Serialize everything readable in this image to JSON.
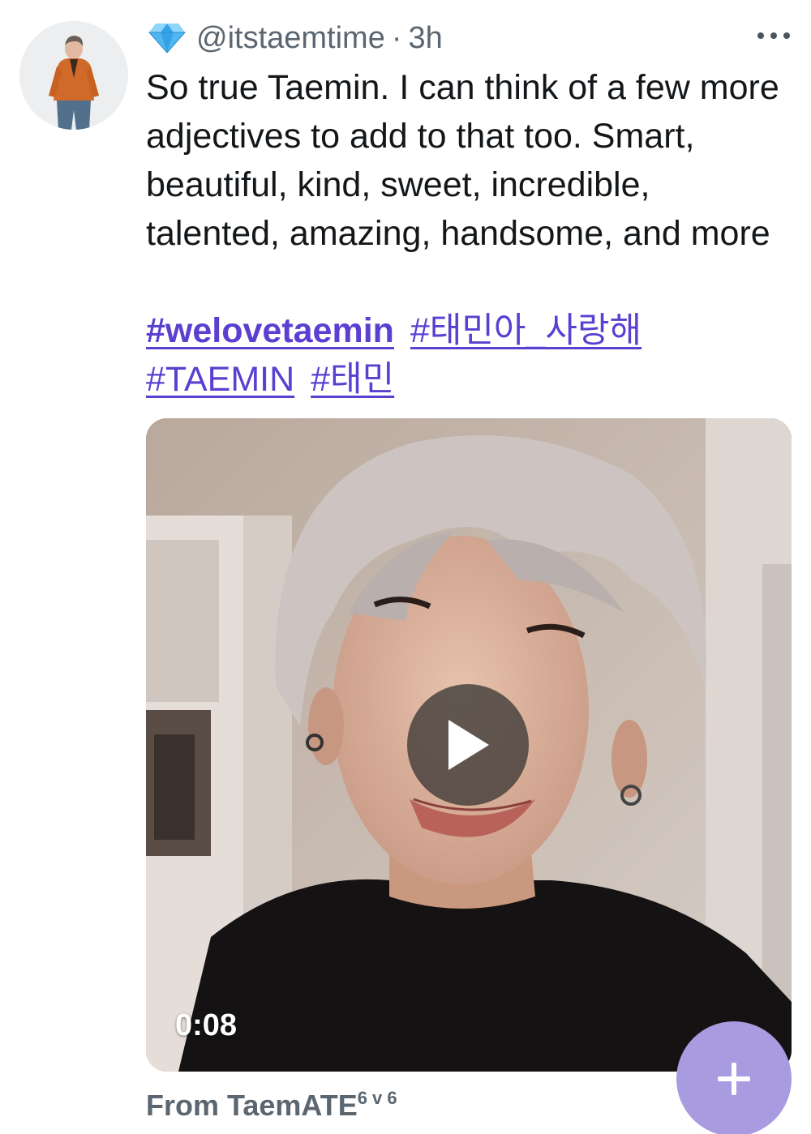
{
  "tweet": {
    "handle": "@itstaemtime",
    "separator": "·",
    "time": "3h",
    "badge_icon": "diamond-icon",
    "more_icon": "more-dots-icon",
    "text": "So true Taemin. I can think of a few more adjectives to add to that too. Smart, beautiful, kind, sweet, incredible, talented, amazing, handsome, and more",
    "hashtags": [
      {
        "label": "#welovetaemin"
      },
      {
        "label": "#태민아_사랑해"
      },
      {
        "label": "#TAEMIN"
      },
      {
        "label": "#태민"
      }
    ],
    "hashtag_color": "#5b3fd1"
  },
  "media": {
    "type": "video",
    "duration": "0:08",
    "play_icon": "play-icon"
  },
  "source": {
    "prefix": "From TaemATE",
    "superscript": "6 v 6"
  },
  "fab": {
    "icon": "plus-icon",
    "color": "#a99be0"
  }
}
